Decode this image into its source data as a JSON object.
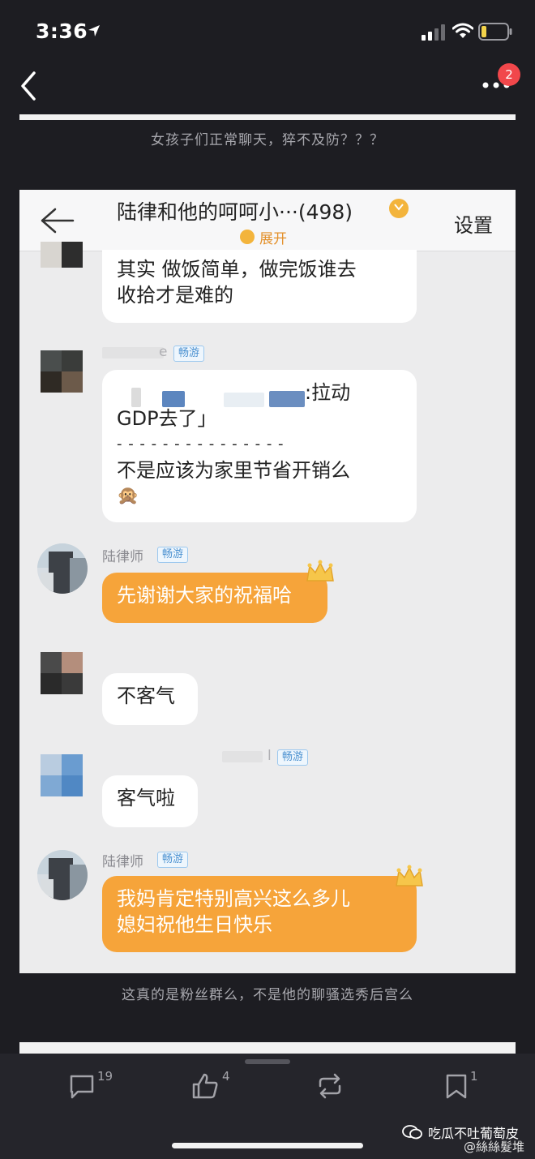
{
  "status_bar": {
    "time": "3:36"
  },
  "nav": {
    "notification_count": "2"
  },
  "captions": {
    "top": "女孩子们正常聊天，猝不及防？？？",
    "bottom": "这真的是粉丝群么，不是他的聊骚选秀后宫么"
  },
  "chat": {
    "title": "陆律和他的呵呵小···(498)",
    "expand_label": "展开",
    "settings_label": "设置",
    "messages": [
      {
        "lines": [
          "其实 做饭简单，做完饭谁去",
          "收拾才是难的"
        ]
      },
      {
        "sender_suffix": "e",
        "tag": "畅游",
        "lines": [
          ":拉动",
          "GDP去了」",
          "- - - - - - - - - - - - - - -",
          "不是应该为家里节省开销么"
        ],
        "emoji": "🙊"
      },
      {
        "sender": "陆律师",
        "tag": "畅游",
        "lines": [
          "先谢谢大家的祝福哈"
        ]
      },
      {
        "lines": [
          "不客气"
        ]
      },
      {
        "sender_suffix": "l",
        "tag": "畅游",
        "lines": [
          "客气啦"
        ]
      },
      {
        "sender": "陆律师",
        "tag": "畅游",
        "lines": [
          "我妈肯定特别高兴这么多儿",
          "媳妇祝他生日快乐"
        ]
      }
    ]
  },
  "actions": {
    "comments": "19",
    "likes": "4",
    "reposts": "",
    "favorites": "1"
  },
  "watermark": {
    "line1": "吃瓜不吐葡萄皮",
    "line2": "@絲絲髮堆"
  },
  "colors": {
    "background": "#1d1d22",
    "chat_background": "#ececed",
    "accent_orange": "#f6a43a",
    "badge_red": "#f1474b",
    "tag_blue": "#4a90d0"
  },
  "icons": [
    "location-arrow-icon",
    "signal-icon",
    "wifi-icon",
    "battery-icon",
    "back-chevron-icon",
    "more-icon",
    "back-arrow-icon",
    "vip-badge-icon",
    "expand-icon",
    "crown-icon",
    "comment-icon",
    "like-icon",
    "repost-icon",
    "favorite-icon",
    "wechat-icon"
  ]
}
